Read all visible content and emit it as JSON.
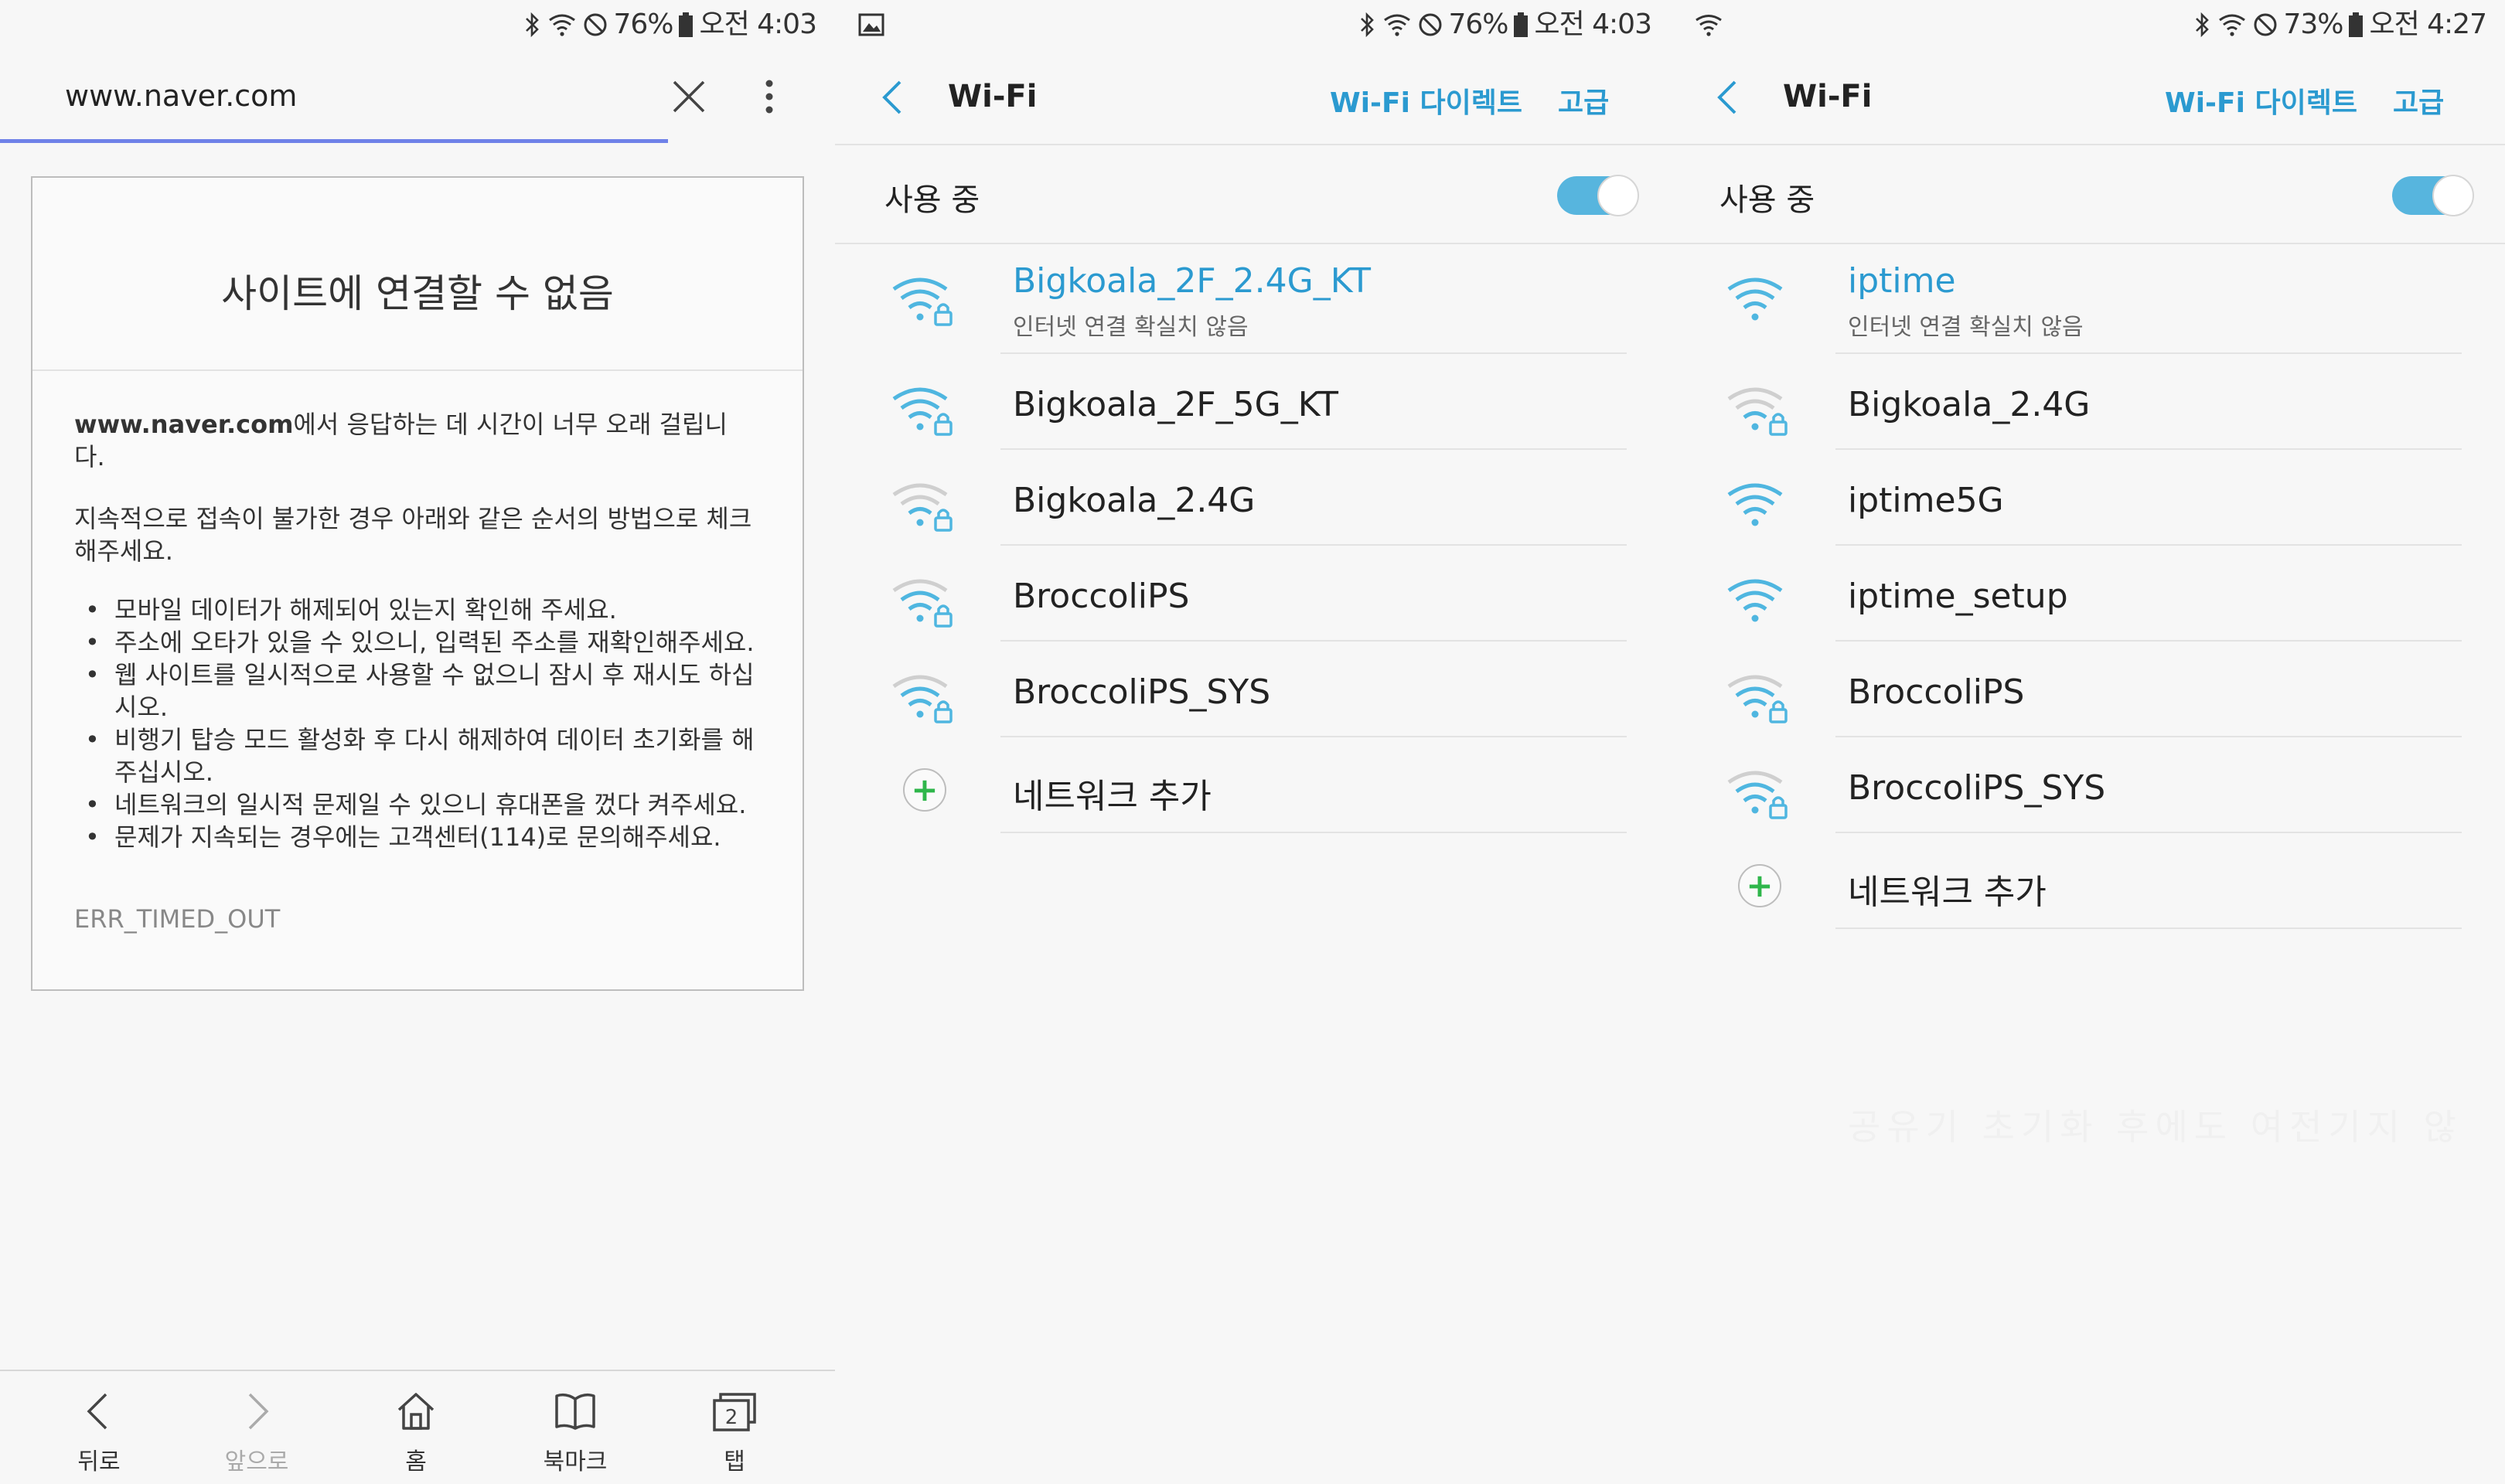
{
  "panel1": {
    "status": {
      "battery_pct": "76%",
      "time": "오전 4:03"
    },
    "address_bar": {
      "url": "www.naver.com"
    },
    "error_card": {
      "title": "사이트에 연결할 수 없음",
      "lead_host": "www.naver.com",
      "lead_rest": "에서 응답하는 데 시간이 너무 오래 걸립니다.",
      "intro": "지속적으로 접속이 불가한 경우 아래와 같은 순서의 방법으로 체크해주세요.",
      "bullets": [
        "모바일 데이터가 해제되어 있는지 확인해 주세요.",
        "주소에 오타가 있을 수 있으니, 입력된 주소를 재확인해주세요.",
        "웹 사이트를 일시적으로 사용할 수 없으니 잠시 후 재시도 하십시오.",
        "비행기 탑승 모드 활성화 후 다시 해제하여 데이터 초기화를 해주십시오.",
        "네트워크의 일시적 문제일 수 있으니 휴대폰을 껐다 켜주세요.",
        "문제가 지속되는 경우에는 고객센터(114)로 문의해주세요."
      ],
      "error_code": "ERR_TIMED_OUT"
    },
    "bottom_nav": {
      "back": "뒤로",
      "forward": "앞으로",
      "home": "홈",
      "bookmarks": "북마크",
      "tabs": "탭",
      "tab_count": "2"
    }
  },
  "panel2": {
    "status": {
      "battery_pct": "76%",
      "time": "오전 4:03"
    },
    "header": {
      "title": "Wi-Fi",
      "direct": "Wi-Fi 다이렉트",
      "advanced": "고급"
    },
    "switch_label": "사용 중",
    "networks": [
      {
        "name": "Bigkoala_2F_2.4G_KT",
        "sub": "인터넷 연결 확실치 않음"
      },
      {
        "name": "Bigkoala_2F_5G_KT"
      },
      {
        "name": "Bigkoala_2.4G"
      },
      {
        "name": "BroccoliPS"
      },
      {
        "name": "BroccoliPS_SYS"
      }
    ],
    "add_network": "네트워크 추가"
  },
  "panel3": {
    "status": {
      "battery_pct": "73%",
      "time": "오전 4:27"
    },
    "header": {
      "title": "Wi-Fi",
      "direct": "Wi-Fi 다이렉트",
      "advanced": "고급"
    },
    "switch_label": "사용 중",
    "networks": [
      {
        "name": "iptime",
        "sub": "인터넷 연결 확실치 않음"
      },
      {
        "name": "Bigkoala_2.4G"
      },
      {
        "name": "iptime5G"
      },
      {
        "name": "iptime_setup"
      },
      {
        "name": "BroccoliPS"
      },
      {
        "name": "BroccoliPS_SYS"
      }
    ],
    "add_network": "네트워크 추가",
    "faint_overlay": "공유기 초기화 후에도 여전기지 않"
  },
  "colors": {
    "accent": "#2b9ad0",
    "toggle": "#57b5de",
    "addr_line": "#6f82e8",
    "add_plus": "#2fb64b"
  }
}
